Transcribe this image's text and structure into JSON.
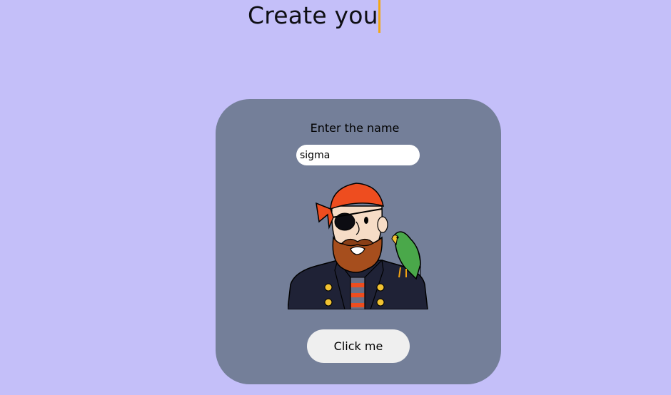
{
  "header": {
    "typing_text": "Create you"
  },
  "form": {
    "label": "Enter the name",
    "name_value": "sigma"
  },
  "avatar": {
    "icon": "pirate-with-parrot-avatar"
  },
  "actions": {
    "submit_label": "Click me"
  },
  "colors": {
    "page_background": "#c4bff9",
    "card_background": "#747f99",
    "caret": "#f2a614",
    "button_background": "#efefef"
  }
}
